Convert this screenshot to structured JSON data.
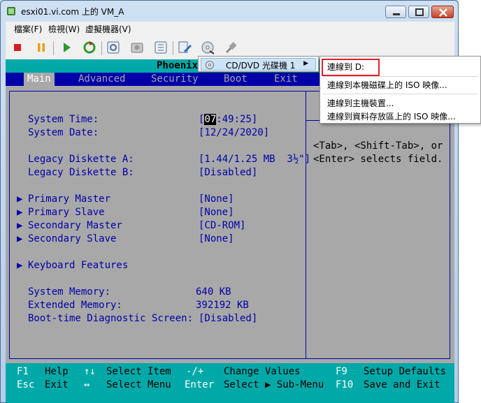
{
  "window": {
    "title": "esxi01.vi.com 上的 VM_A"
  },
  "menubar": {
    "items": [
      "檔案(F)",
      "檢視(W)",
      "虛擬機器(V)"
    ]
  },
  "bios": {
    "title": "PhoenixI",
    "tabs": [
      "Main",
      "Advanced",
      "Security",
      "Boot",
      "Exit"
    ],
    "active_tab": "Main",
    "fields": {
      "system_time_label": "System Time:",
      "system_time_cursor": "07",
      "system_time_rest": ":49:25]",
      "system_time_bracket": "[",
      "system_date_label": "System Date:",
      "system_date_value": "[12/24/2020]",
      "diskette_a_label": "Legacy Diskette A:",
      "diskette_a_value": "[1.44/1.25 MB  3½\"]",
      "diskette_b_label": "Legacy Diskette B:",
      "diskette_b_value": "[Disabled]",
      "primary_master_label": "Primary Master",
      "primary_master_value": "[None]",
      "primary_slave_label": "Primary Slave",
      "primary_slave_value": "[None]",
      "secondary_master_label": "Secondary Master",
      "secondary_master_value": "[CD-ROM]",
      "secondary_slave_label": "Secondary Slave",
      "secondary_slave_value": "[None]",
      "keyboard_label": "Keyboard Features",
      "system_memory_label": "System Memory:",
      "system_memory_value": "640 KB",
      "extended_memory_label": "Extended Memory:",
      "extended_memory_value": "392192 KB",
      "boot_diag_label": "Boot-time Diagnostic Screen:",
      "boot_diag_value": "[Disabled]"
    },
    "help": {
      "line1": "<Tab>, <Shift-Tab>, or",
      "line2": "<Enter> selects field."
    },
    "footer": {
      "row1": [
        {
          "key": "F1",
          "text": "Help"
        },
        {
          "key": "↑↓",
          "text": "Select Item"
        },
        {
          "key": "-/+",
          "text": "Change Values"
        },
        {
          "key": "F9",
          "text": "Setup Defaults"
        }
      ],
      "row2": [
        {
          "key": "Esc",
          "text": "Exit"
        },
        {
          "key": "↔",
          "text": "Select Menu"
        },
        {
          "key": "Enter",
          "text": "Select ▶ Sub-Menu"
        },
        {
          "key": "F10",
          "text": "Save and Exit"
        }
      ]
    }
  },
  "context_menu": {
    "device_label": "CD/DVD 光碟機 1",
    "submenu": [
      "連線到 D:",
      "連線到本機磁碟上的 ISO 映像...",
      "連線到主機裝置...",
      "連線到資料存放區上的 ISO 映像..."
    ]
  },
  "colors": {
    "bios_blue": "#0000a8",
    "bios_cyan": "#00a8a8",
    "bios_gray": "#a8a8a8",
    "highlight_red": "#e0202a"
  }
}
